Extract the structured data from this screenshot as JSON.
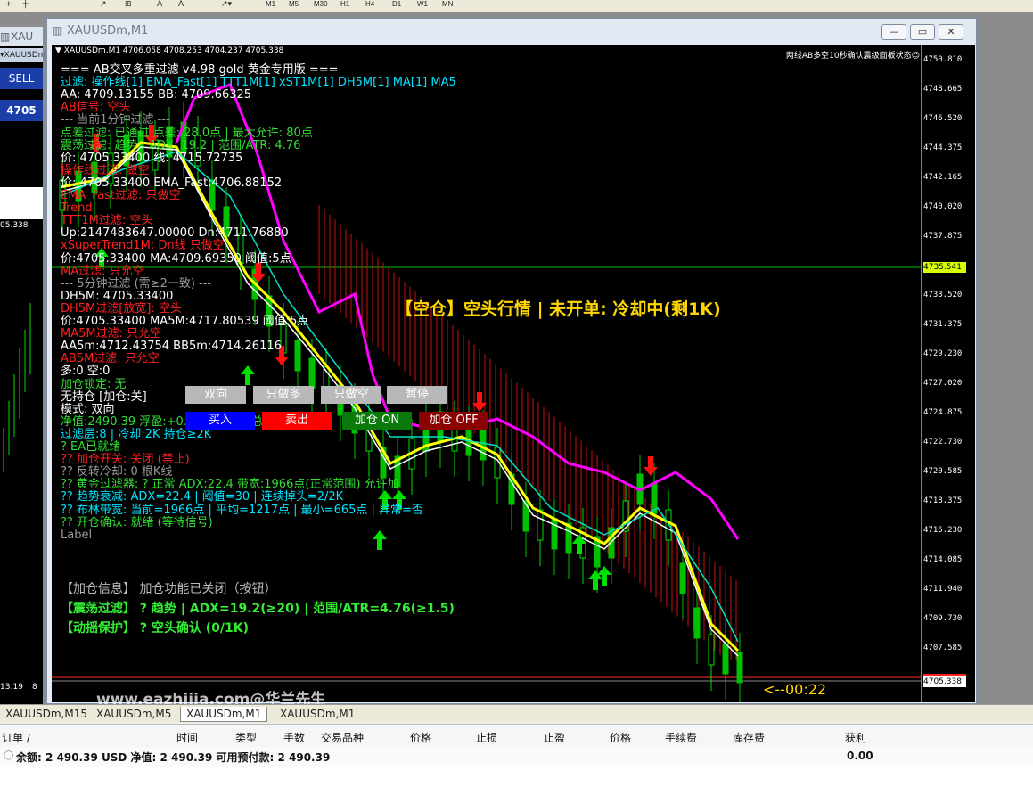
{
  "toolbar": {
    "tools": [
      "+",
      "↗",
      "A",
      "A"
    ],
    "timeframes": [
      "M1",
      "M5",
      "M30",
      "H1",
      "H4",
      "D1",
      "W1",
      "MN"
    ]
  },
  "left_window": {
    "title": "XAU",
    "symbol": "XAUUSDm",
    "sell_label": "SELL",
    "price": "4705",
    "axis_price": "05.338",
    "time_a": "13:19",
    "time_b": "8"
  },
  "main_window": {
    "title": "XAUUSDm,M1",
    "buttons": [
      "—",
      "▭",
      "✕"
    ]
  },
  "chart": {
    "header": "XAUUSDm,M1 4706.058 4708.253 4704.237 4705.338",
    "top_right": "两线AB多空10秒确认震级面板状态☺",
    "price_scale": [
      "4750.810",
      "4748.665",
      "4746.520",
      "4744.375",
      "4742.165",
      "4740.020",
      "4737.875",
      "4735.541",
      "4733.520",
      "4731.375",
      "4729.230",
      "4727.020",
      "4724.875",
      "4722.730",
      "4720.585",
      "4718.375",
      "4716.230",
      "4714.085",
      "4711.940",
      "4709.730",
      "4707.585",
      "4705.338"
    ],
    "current_line_price": "4735.541",
    "current_price": "4705.338",
    "timer": "<--00:22",
    "watermark": "www.eazhijia.com@华兰先生",
    "status_big": "【空仓】空头行情 | 未开单: 冷却中(剩1K)",
    "overlay_lines": [
      {
        "text": "=== AB交叉多重过滤 v4.98 gold 黄金专用版 ===",
        "color": "#ffffff"
      },
      {
        "text": "过滤: 操作线[1] EMA_Fast[1] TTT1M[1] xST1M[1] DH5M[1] MA[1] MA5",
        "color": "#00e5ff"
      },
      {
        "text": "AA: 4709.13155 BB: 4709.66325",
        "color": "#ffffff"
      },
      {
        "text": "AB信号: 空头",
        "color": "#ff2020"
      },
      {
        "text": "--- 当前1分钟过滤 ---",
        "color": "#9a9a9a"
      },
      {
        "text": "点差过滤: 已通过 点差: 28.0点 | 最大允许: 80点",
        "color": "#33dd33"
      },
      {
        "text": "震荡过滤: 趋势 | ADX: 19.2 | 范围/ATR: 4.76",
        "color": "#33dd33"
      },
      {
        "text": "价: 4705.33400 线: 4715.72735",
        "color": "#ffffff"
      },
      {
        "text": "操作线过滤: 做空",
        "color": "#ff2020"
      },
      {
        "text": "价: 4705.33400 EMA_Fast:4706.88152",
        "color": "#ffffff"
      },
      {
        "text": "EMA_Fast过滤: 只做空",
        "color": "#ff2020"
      },
      {
        "text": "Trend",
        "color": "#ff2020"
      },
      {
        "text": "TTT1M过滤: 空头",
        "color": "#ff2020"
      },
      {
        "text": "Up:2147483647.00000 Dn:4711.76880",
        "color": "#ffffff"
      },
      {
        "text": "xSuperTrend1M: Dn线 只做空",
        "color": "#ff2020"
      },
      {
        "text": "价:4705.33400 MA:4709.69350 阈值:5点",
        "color": "#ffffff"
      },
      {
        "text": "MA过滤: 只允空",
        "color": "#ff2020"
      },
      {
        "text": "--- 5分钟过滤 (需≥2一致) ---",
        "color": "#9a9a9a"
      },
      {
        "text": "DH5M: 4705.33400",
        "color": "#ffffff"
      },
      {
        "text": "DH5M过滤[放宽]: 空头",
        "color": "#ff2020"
      },
      {
        "text": "价:4705.33400 MA5M:4717.80539 阈值:5点",
        "color": "#ffffff"
      },
      {
        "text": "MA5M过滤: 只允空",
        "color": "#ff2020"
      },
      {
        "text": "AA5m:4712.43754 BB5m:4714.26116",
        "color": "#ffffff"
      },
      {
        "text": "AB5M过滤: 只允空",
        "color": "#ff2020"
      },
      {
        "text": "多:0 空:0",
        "color": "#ffffff"
      },
      {
        "text": "加仓锁定: 无",
        "color": "#33dd33"
      },
      {
        "text": "无持仓 [加仓:关]",
        "color": "#ffffff"
      },
      {
        "text": "模式: 双向",
        "color": "#ffffff"
      },
      {
        "text": "净值:2490.39 浮盈:+0.00(0.00%) 总亏:-0.00%",
        "color": "#33dd33"
      },
      {
        "text": "过滤层:8 | 冷却:2K 持仓≥2K",
        "color": "#00e5ff"
      },
      {
        "text": "? EA已就绪",
        "color": "#33dd33"
      },
      {
        "text": "?? 加仓开关: 关闭 (禁止)",
        "color": "#ff2020"
      },
      {
        "text": "?? 反转冷却: 0 根K线",
        "color": "#9a9a9a"
      },
      {
        "text": "?? 黄金过滤器: ? 正常 ADX:22.4 带宽:1966点(正常范围) 允许加",
        "color": "#33dd33"
      },
      {
        "text": "?? 趋势衰减: ADX=22.4 | 阈值=30 | 连续掉头=2/2K",
        "color": "#00e5ff"
      },
      {
        "text": "?? 布林带宽: 当前=1966点 | 平均=1217点 | 最小=665点 | 异常=否",
        "color": "#00e5ff"
      },
      {
        "text": "?? 开仓确认: 就绪 (等待信号)",
        "color": "#33dd33"
      },
      {
        "text": "Label",
        "color": "#9a9a9a"
      }
    ],
    "bottom_info": [
      {
        "text": "【加仓信息】 加仓功能已关闭（按钮）",
        "color": "#bbbbbb"
      },
      {
        "text": "【震荡过滤】 ? 趋势 | ADX=19.2(≥20) | 范围/ATR=4.76(≥1.5)",
        "color": "#33ee33"
      },
      {
        "text": "【动摇保护】 ? 空头确认 (0/1K)",
        "color": "#33ee33"
      }
    ],
    "panel_buttons_row1": [
      "双向",
      "只做多",
      "只做空",
      "暂停"
    ],
    "panel_buttons_row2": [
      {
        "label": "买入",
        "color": "#0000ff"
      },
      {
        "label": "卖出",
        "color": "#ff0000"
      },
      {
        "label": "加仓 ON",
        "color": "#0a7a0a"
      },
      {
        "label": "加仓 OFF",
        "color": "#8b0000"
      }
    ]
  },
  "tabs": [
    "XAUUSDm,M15",
    "XAUUSDm,M5",
    "XAUUSDm,M1",
    "XAUUSDm,M1"
  ],
  "active_tab": "XAUUSDm,M1",
  "terminal": {
    "headers": [
      "订单 /",
      "时间",
      "类型",
      "手数",
      "交易品种",
      "价格",
      "止损",
      "止盈",
      "价格",
      "手续费",
      "库存费",
      "获利"
    ],
    "balance_row": "余额: 2 490.39 USD  净值: 2 490.39  可用预付款: 2 490.39",
    "profit": "0.00"
  }
}
